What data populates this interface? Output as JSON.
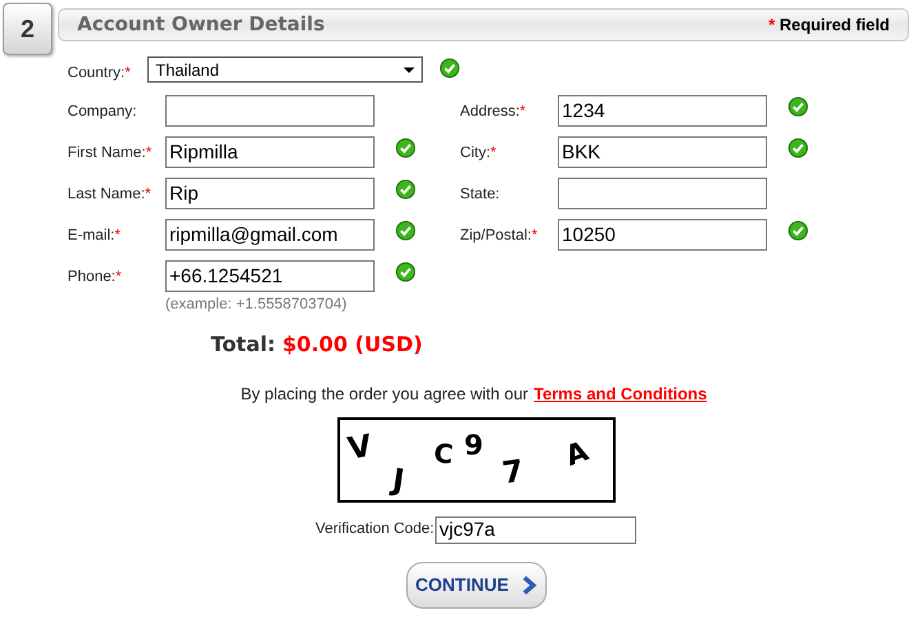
{
  "step": "2",
  "header": {
    "title": "Account Owner Details",
    "required_mark": "*",
    "required_note": "Required field"
  },
  "rows": [
    {
      "left": {
        "kind": "select",
        "label": "Country:",
        "required": true,
        "value": "Thailand",
        "valid": true
      }
    },
    {
      "left": {
        "kind": "text",
        "label": "Company:",
        "required": false,
        "valid": false
      },
      "right": {
        "kind": "text",
        "label": "Address:",
        "required": true,
        "value": "1234",
        "valid": true
      }
    },
    {
      "left": {
        "kind": "text",
        "label": "First Name:",
        "required": true,
        "value": "Ripmilla",
        "valid": true
      },
      "right": {
        "kind": "text",
        "label": "City:",
        "required": true,
        "value": "BKK",
        "valid": true
      }
    },
    {
      "left": {
        "kind": "text",
        "label": "Last Name:",
        "required": true,
        "value": "Rip",
        "valid": true
      },
      "right": {
        "kind": "text",
        "label": "State:",
        "required": false,
        "valid": false
      }
    },
    {
      "left": {
        "kind": "text",
        "label": "E-mail:",
        "required": true,
        "value": "ripmilla@gmail.com",
        "valid": true
      },
      "right": {
        "kind": "text",
        "label": "Zip/Postal:",
        "required": true,
        "value": "10250",
        "valid": true
      }
    },
    {
      "left": {
        "kind": "text",
        "label": "Phone:",
        "required": true,
        "value": "+66.1254521",
        "valid": true,
        "hint": "(example: +1.5558703704)"
      }
    }
  ],
  "total": {
    "label": "Total:",
    "amount": "$0.00 (USD)"
  },
  "agreement": {
    "text": "By placing the order you agree with our",
    "link": "Terms and Conditions"
  },
  "captcha": {
    "characters": [
      "V",
      "J",
      "C",
      "9",
      "7",
      "A"
    ]
  },
  "verification": {
    "label": "Verification Code:",
    "value": "vjc97a"
  },
  "continue_button": {
    "label": "CONTINUE"
  }
}
